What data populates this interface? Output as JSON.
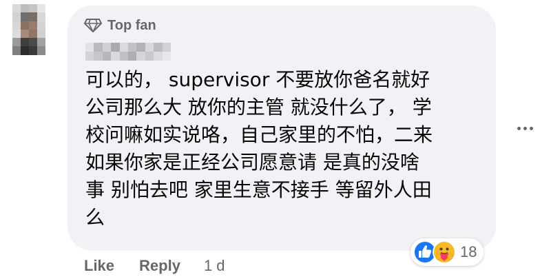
{
  "comment": {
    "badge": {
      "icon": "diamond-icon",
      "label": "Top fan"
    },
    "text_lines": [
      "可以的， supervisor 不要放你爸名就好",
      "公司那么大 放你的主管 就没什么了， 学",
      "校问嘛如实说咯，自己家里的不怕，二来",
      "如果你家是正经公司愿意请 是真的没啥",
      "事 别怕去吧 家里生意不接手 等留外人田",
      "么"
    ],
    "reactions": {
      "icons": [
        "like-icon",
        "care-icon"
      ],
      "count": "18"
    },
    "actions": {
      "like": "Like",
      "reply": "Reply",
      "time": "1 d"
    },
    "more_icon": "more-options-icon"
  },
  "colors": {
    "bubble_background": "#f0f2f5",
    "text_primary": "#050505",
    "text_secondary": "#65676b",
    "like_blue": "#1877f2",
    "care_yellow": "#f7b928"
  }
}
